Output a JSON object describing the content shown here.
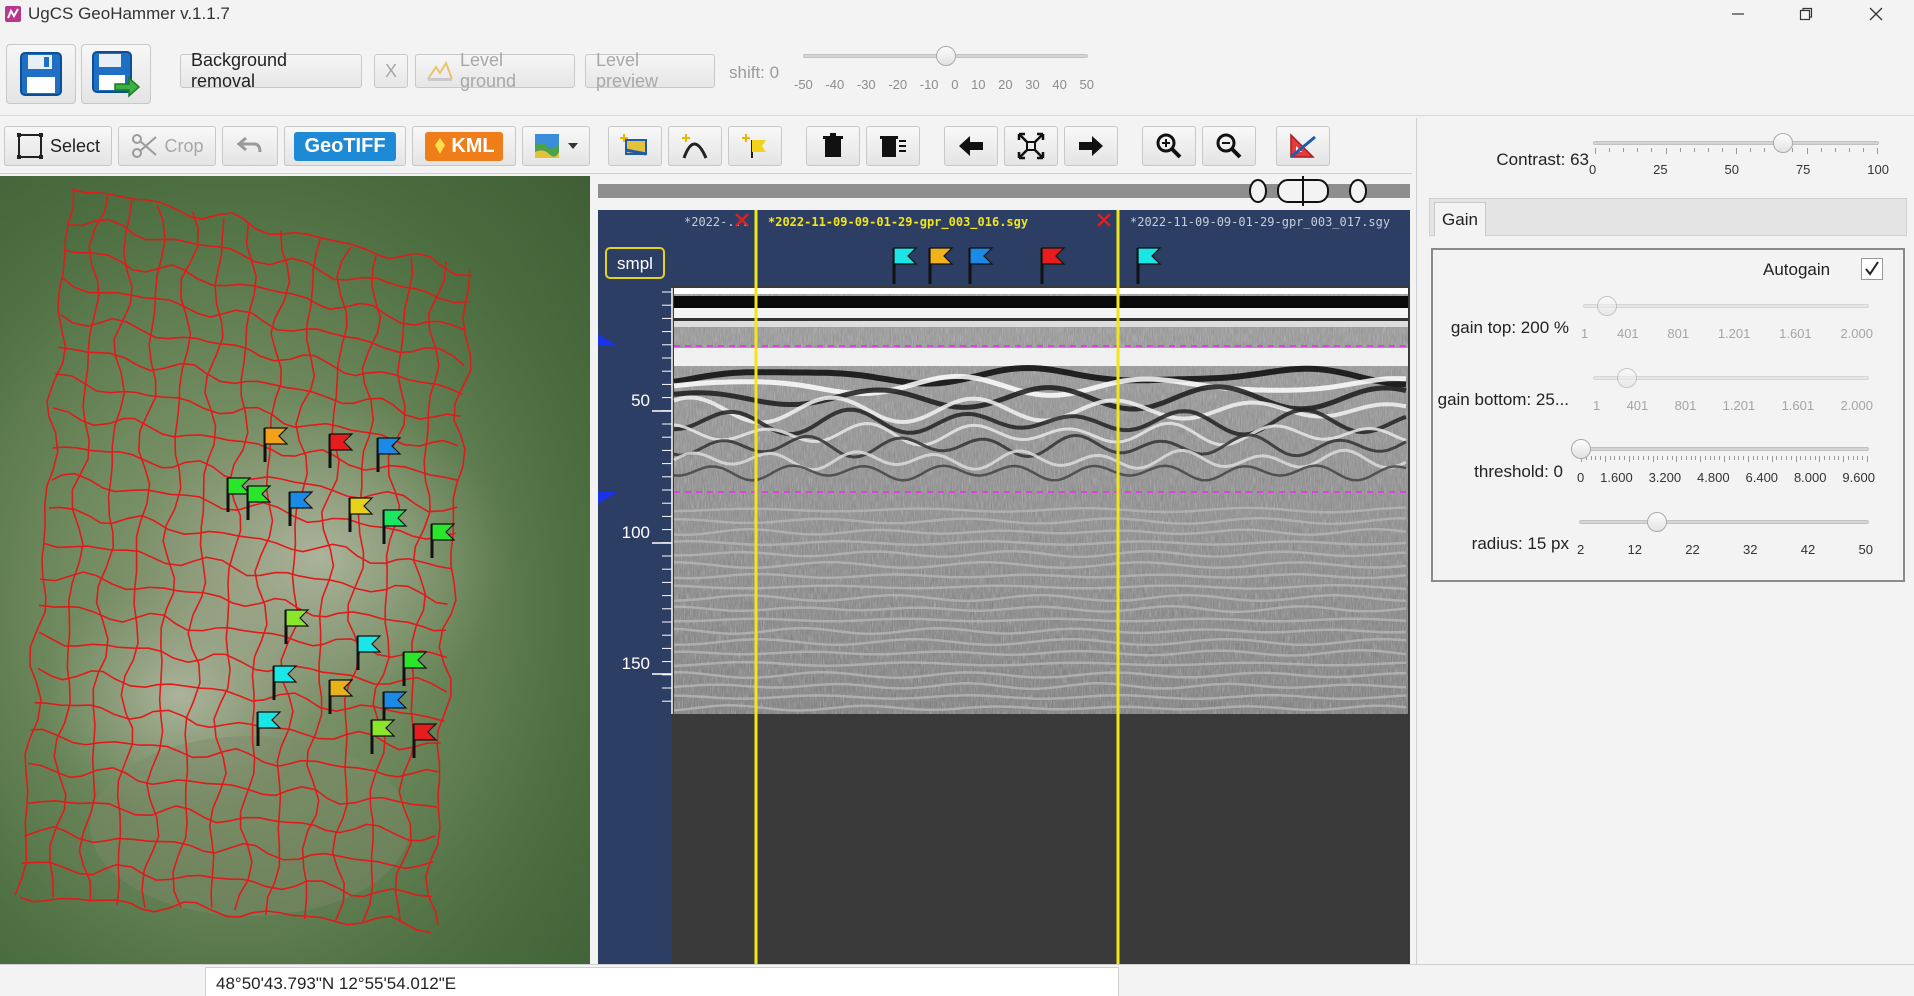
{
  "app": {
    "title": "UgCS GeoHammer v.1.1.7"
  },
  "toolbar": {
    "background_removal": "Background removal",
    "x_label": "X",
    "level_ground": "Level ground",
    "level_preview": "Level preview",
    "shift_label": "shift: 0",
    "shift_value": 0,
    "shift_ticks": [
      "-50",
      "-40",
      "-30",
      "-20",
      "-10",
      "0",
      "10",
      "20",
      "30",
      "40",
      "50"
    ]
  },
  "toolbar2": {
    "select": "Select",
    "crop": "Crop",
    "geotiff": "GeoTIFF",
    "kml": "KML"
  },
  "radar": {
    "smpl_label": "smpl",
    "file_left": "*2022-...",
    "file_active": "*2022-11-09-09-01-29-gpr_003_016.sgy",
    "file_right": "*2022-11-09-09-01-29-gpr_003_017.sgy",
    "depth_ticks": [
      "50",
      "100",
      "150"
    ]
  },
  "right_panel": {
    "contrast_label": "Contrast: 63",
    "contrast_value": 63,
    "contrast_ticks": [
      "0",
      "25",
      "50",
      "75",
      "100"
    ],
    "gain_tab": "Gain",
    "autogain_label": "Autogain",
    "autogain_checked": true,
    "gain_top_label": "gain top: 200 %",
    "gain_bottom_label": "gain bottom: 25...",
    "gain_ticks": [
      "1",
      "401",
      "801",
      "1.201",
      "1.601",
      "2.000"
    ],
    "threshold_label": "threshold: 0",
    "threshold_ticks": [
      "0",
      "1.600",
      "3.200",
      "4.800",
      "6.400",
      "8.000",
      "9.600"
    ],
    "radius_label": "radius: 15 px",
    "radius_ticks": [
      "2",
      "12",
      "22",
      "32",
      "42",
      "50"
    ]
  },
  "status": {
    "coordinates": "48°50'43.793\"N  12°55'54.012\"E"
  },
  "colors": {
    "accent_blue": "#1e8ad6",
    "kml_orange": "#ef7d1a",
    "radar_header": "#2c3e63",
    "cursor_yellow": "#f2e51a",
    "grid_red": "#e01b1b"
  }
}
